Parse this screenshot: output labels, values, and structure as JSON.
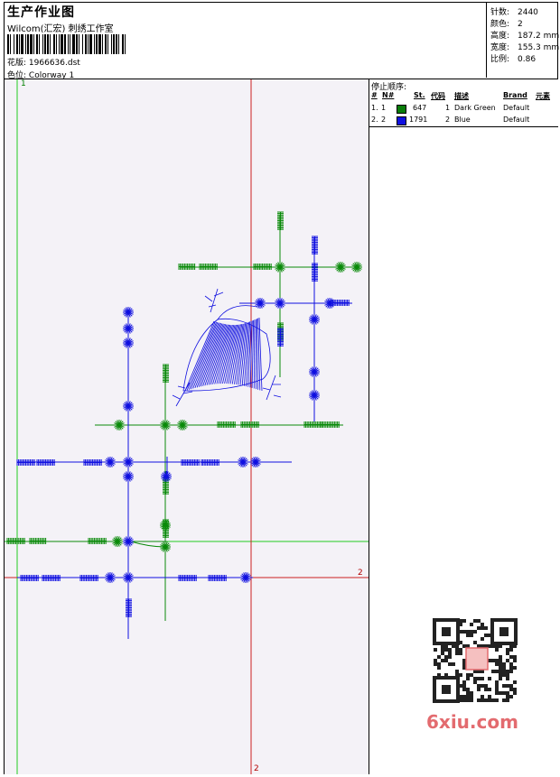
{
  "header": {
    "title": "生产作业图",
    "subtitle": "Wilcom(汇宏) 刺绣工作室",
    "design_label": "花版:",
    "design_value": "1966636.dst",
    "colorway_label": "色位:",
    "colorway_value": "Colorway 1"
  },
  "stats": [
    {
      "label": "针数:",
      "value": "2440"
    },
    {
      "label": "颜色:",
      "value": "2"
    },
    {
      "label": "高度:",
      "value": "187.2 mm"
    },
    {
      "label": "宽度:",
      "value": "155.3 mm"
    },
    {
      "label": "比例:",
      "value": "0.86"
    }
  ],
  "stop_sequence": {
    "title": "停止顺序:",
    "headers": {
      "num": "#",
      "no": "N#",
      "st": "St.",
      "code": "代码",
      "desc": "描述",
      "brand": "Brand",
      "elem": "元素"
    },
    "rows": [
      {
        "num": "1.",
        "no": "1",
        "color": "#0a7d0a",
        "st": "647",
        "code": "1",
        "desc": "Dark Green",
        "brand": "Default"
      },
      {
        "num": "2.",
        "no": "2",
        "color": "#1010e0",
        "st": "1791",
        "code": "2",
        "desc": "Blue",
        "brand": "Default"
      }
    ]
  },
  "axes": {
    "green_v_label": "1",
    "red_h_label": "2",
    "red_v_label": "2"
  },
  "watermark": {
    "text": "6xiu.com",
    "seal": "汉雕图形"
  },
  "colors": {
    "green": "#0a8a0a",
    "blue": "#1010e0",
    "red": "#c00000",
    "guide_green": "#22cc22"
  }
}
